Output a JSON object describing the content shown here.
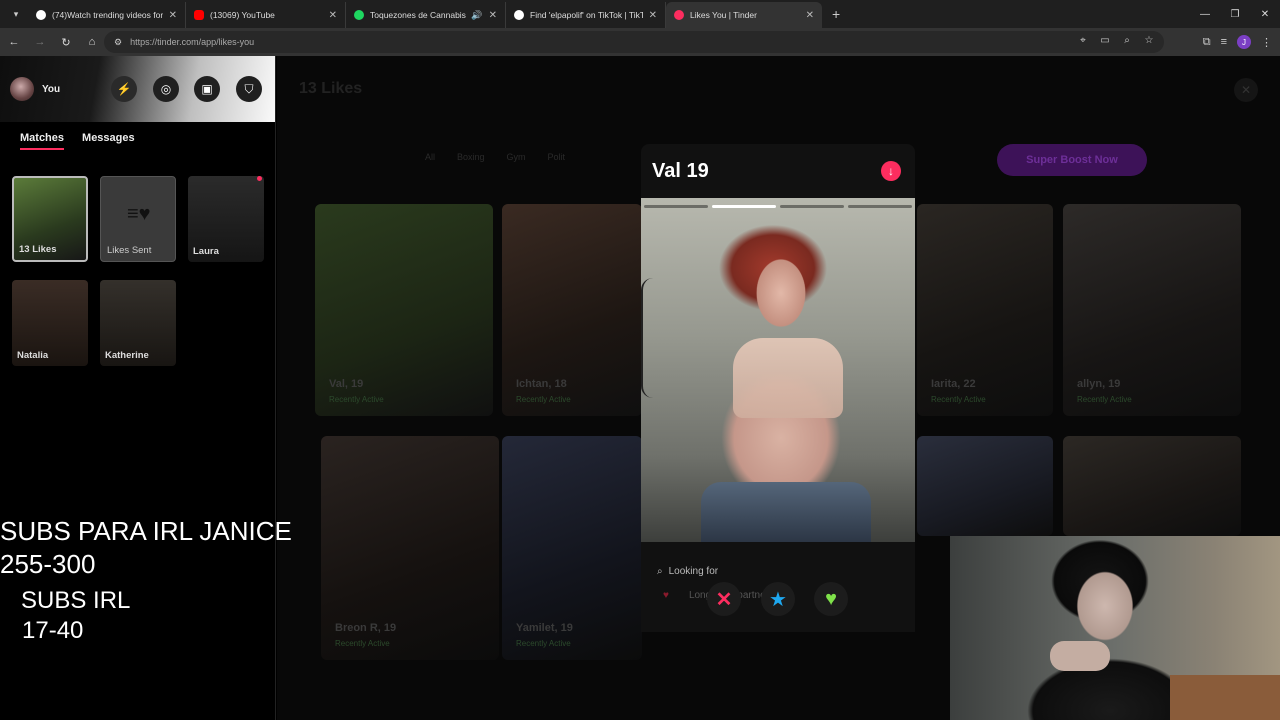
{
  "browser": {
    "tabs": [
      {
        "title": "(74)Watch trending videos for y",
        "favicon_color": "#ffffff",
        "icon": "tiktok-icon"
      },
      {
        "title": "(13069) YouTube",
        "favicon_color": "#ff0000",
        "icon": "youtube-icon"
      },
      {
        "title": "Toquezones de Cannabis - ",
        "favicon_color": "#1ed760",
        "icon": "spotify-icon"
      },
      {
        "title": "Find 'elpapolif' on TikTok | TikTo",
        "favicon_color": "#ffffff",
        "icon": "tiktok-icon"
      },
      {
        "title": "Likes You | Tinder",
        "favicon_color": "#fd2d5f",
        "icon": "tinder-icon"
      }
    ],
    "url": "https://tinder.com/app/likes-you",
    "profile_initial": "J"
  },
  "sidebar": {
    "user_name": "You",
    "tabs": [
      {
        "label": "Matches",
        "active": true
      },
      {
        "label": "Messages",
        "active": false
      }
    ],
    "matches": [
      {
        "label": "13 Likes"
      },
      {
        "label": "Likes Sent"
      },
      {
        "label": "Laura"
      },
      {
        "label": "Natalia"
      },
      {
        "label": "Katherine"
      }
    ]
  },
  "overlay": {
    "line1": "SUBS PARA IRL JANICE",
    "line2": "255-300",
    "line3": "SUBS IRL",
    "line4": "17-40"
  },
  "main": {
    "title": "13 Likes",
    "filters": [
      "All",
      "Boxing",
      "Gym",
      "Polit"
    ],
    "boost_label": "Super Boost Now",
    "cards": [
      {
        "name": "Val, 19",
        "status": "Recently Active"
      },
      {
        "name": "Ichtan, 18",
        "status": "Recently Active"
      },
      {
        "name": "Iarita, 22",
        "status": "Recently Active"
      },
      {
        "name": "allyn, 19",
        "status": "Recently Active"
      },
      {
        "name": "Breon R, 19",
        "status": "Recently Active"
      },
      {
        "name": "Yamilet, 19",
        "status": "Recently Active"
      }
    ]
  },
  "profile": {
    "name": "Val",
    "age": "19",
    "photo_count": 4,
    "photo_index": 2,
    "looking_for_label": "Looking for",
    "looking_for_value": "Long-term partner"
  },
  "colors": {
    "tinder_accent": "#fd2d5f",
    "superlike": "#1ea8f0",
    "like": "#7fe24a",
    "boost": "#a64dff"
  }
}
